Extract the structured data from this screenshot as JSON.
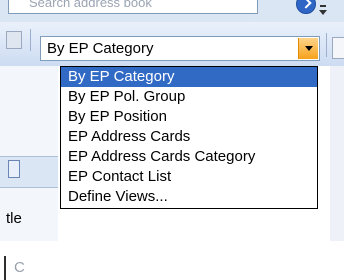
{
  "top": {
    "search_text": "Search address book",
    "go_icon": "go-arrow-icon",
    "overflow_icon": "toolbar-overflow-icon"
  },
  "view_selector": {
    "selected": "By EP Category",
    "arrow_icon": "dropdown-arrow-icon",
    "accent_color": "#f7a21c"
  },
  "dropdown": {
    "items": [
      "By EP Category",
      "By EP Pol. Group",
      "By EP Position",
      "EP Address Cards",
      "EP Address Cards Category",
      "EP Contact List",
      "Define Views..."
    ],
    "highlighted_color": "#316ac5"
  },
  "background": {
    "partial_text_1": "tle",
    "partial_text_2": "C"
  }
}
